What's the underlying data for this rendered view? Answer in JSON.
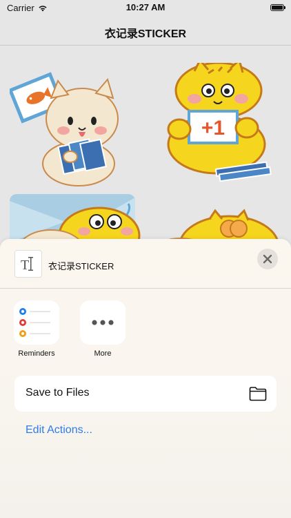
{
  "status_bar": {
    "carrier": "Carrier",
    "time": "10:27 AM",
    "battery_level": 1.0
  },
  "nav": {
    "title": "衣记录STICKER"
  },
  "share_sheet": {
    "title": "衣记录STICKER",
    "doc_icon": "text-document-icon",
    "close_icon": "xmark-icon",
    "apps": [
      {
        "label": "Reminders",
        "icon": "reminders-icon"
      },
      {
        "label": "More",
        "icon": "ellipsis-icon"
      }
    ],
    "actions": [
      {
        "label": "Save to Files",
        "icon": "folder-icon"
      }
    ],
    "edit_actions": "Edit Actions..."
  },
  "colors": {
    "accent": "#2f7bea",
    "sticker_yellow": "#f6d51e",
    "sticker_cream": "#f4e7cf",
    "sticker_orange": "#d7711f"
  }
}
